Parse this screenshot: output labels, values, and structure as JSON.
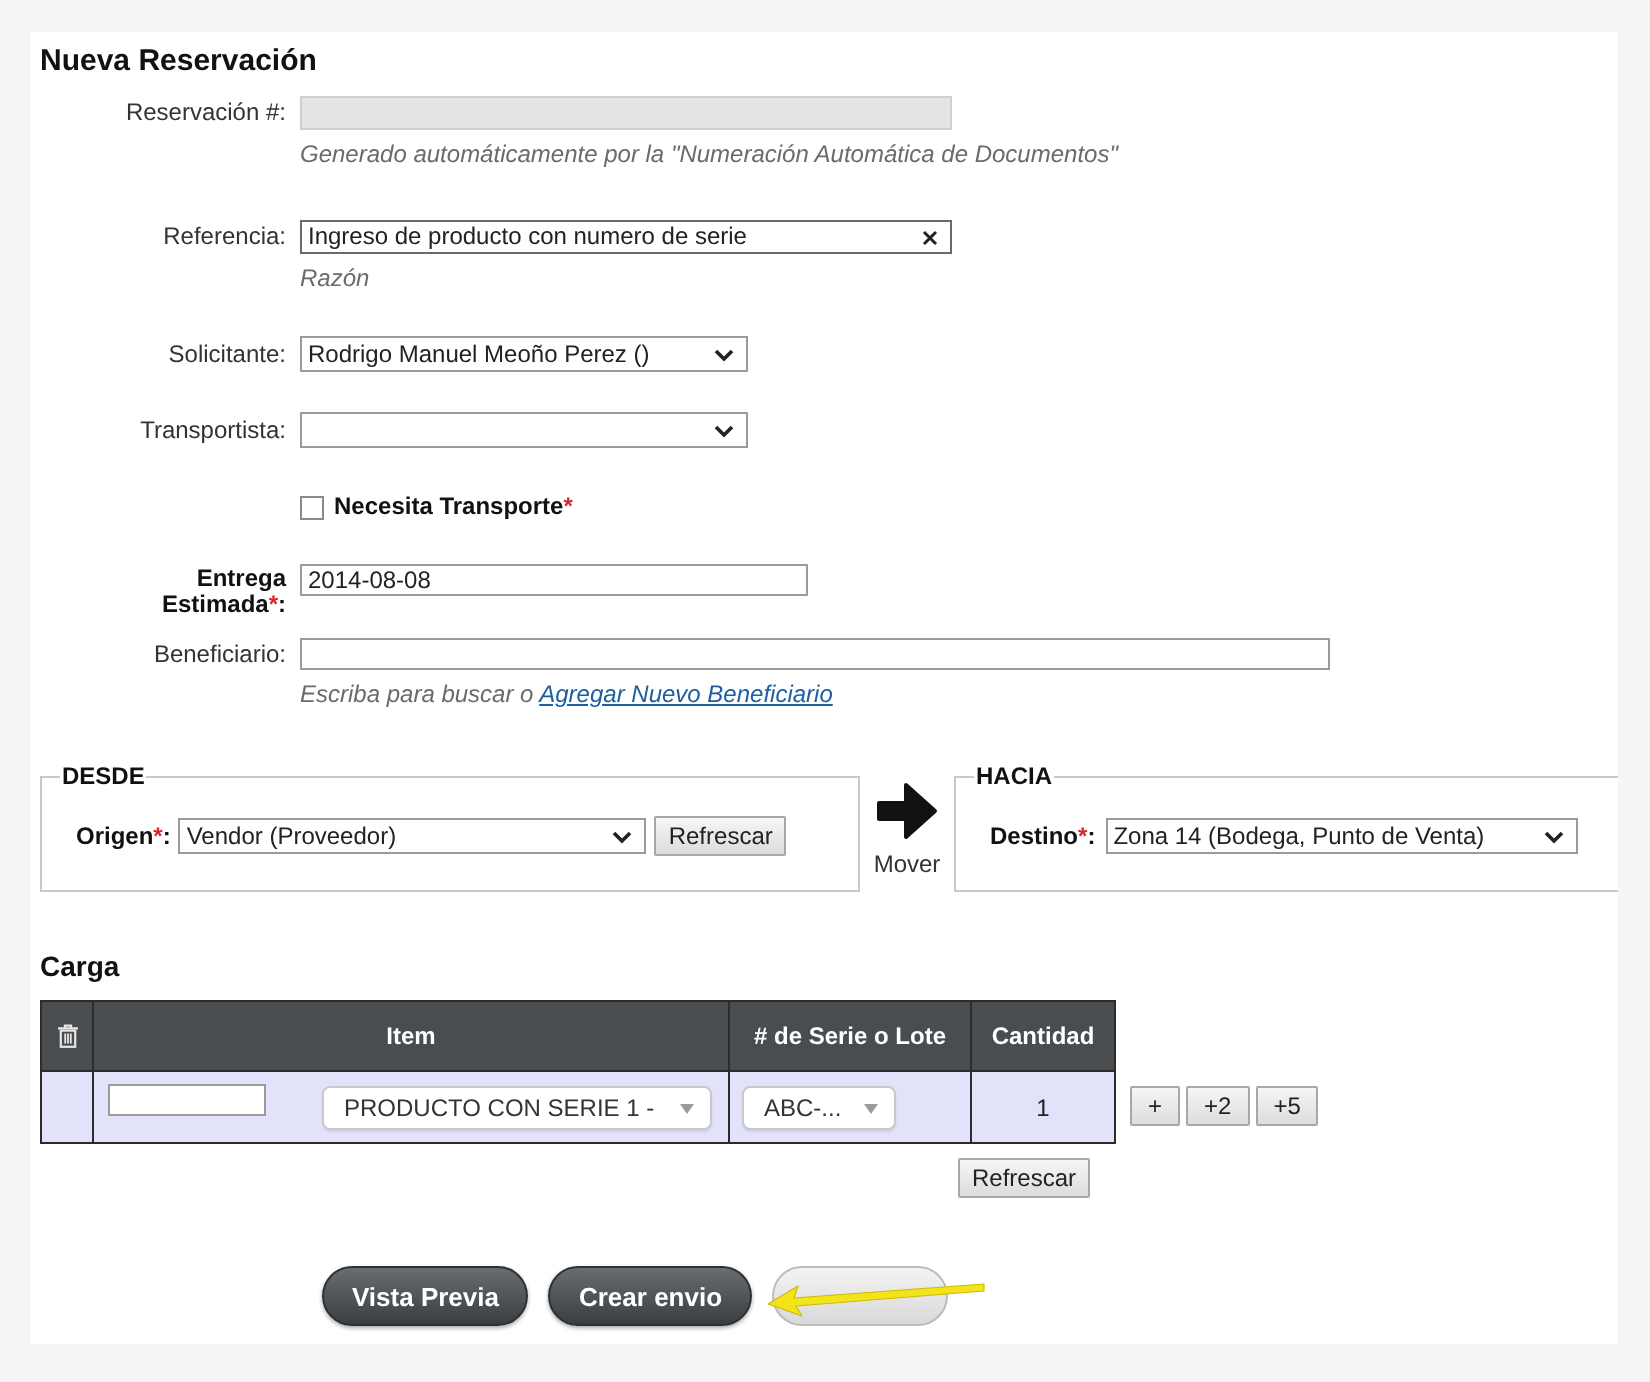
{
  "title": "Nueva Reservación",
  "fields": [
    {
      "kind": "readonly",
      "label": "Reservación #:",
      "hint": "Generado automáticamente por la \"Numeración Automática de Documentos\""
    },
    {
      "kind": "text",
      "label": "Referencia:",
      "value": "Ingreso de producto con numero de serie",
      "clearable": true,
      "hint": "Razón"
    },
    {
      "kind": "select",
      "label": "Solicitante:",
      "value": "Rodrigo Manuel Meoño Perez ()"
    },
    {
      "kind": "select",
      "label": "Transportista:"
    },
    {
      "kind": "checkbox",
      "label": "Necesita Transporte",
      "mark": "*",
      "checked": false
    },
    {
      "kind": "date",
      "label": "Entrega Estimada",
      "mark": "*",
      "end": ":",
      "value": "2014-08-08"
    },
    {
      "kind": "text",
      "label": "Beneficiario:",
      "hint": "Escriba para buscar o",
      "link": "Agregar Nuevo Beneficiario"
    }
  ],
  "locations": [
    {
      "legend": "DESDE",
      "label": "Origen",
      "mark": "*",
      "end": ":",
      "value": "Vendor (Proveedor)",
      "button": "Refrescar"
    },
    {
      "legend": "HACIA",
      "label": "Destino",
      "mark": "*",
      "end": ":",
      "value": "Zona 14 (Bodega, Punto de Venta)"
    }
  ],
  "move_label": "Mover",
  "cargo": {
    "title": "Carga",
    "columns": [
      "Item",
      "# de Serie o Lote",
      "Cantidad"
    ],
    "rows": [
      {
        "item": "PRODUCTO CON SERIE 1 -",
        "serial": "ABC-...",
        "quantity": "1"
      }
    ],
    "step_buttons": [
      "+",
      "+2",
      "+5"
    ],
    "refresh_button": "Refrescar"
  },
  "actions": [
    {
      "kind": "dark",
      "label": "Vista Previa"
    },
    {
      "kind": "dark",
      "label": "Crear envio"
    },
    {
      "kind": "light"
    }
  ]
}
